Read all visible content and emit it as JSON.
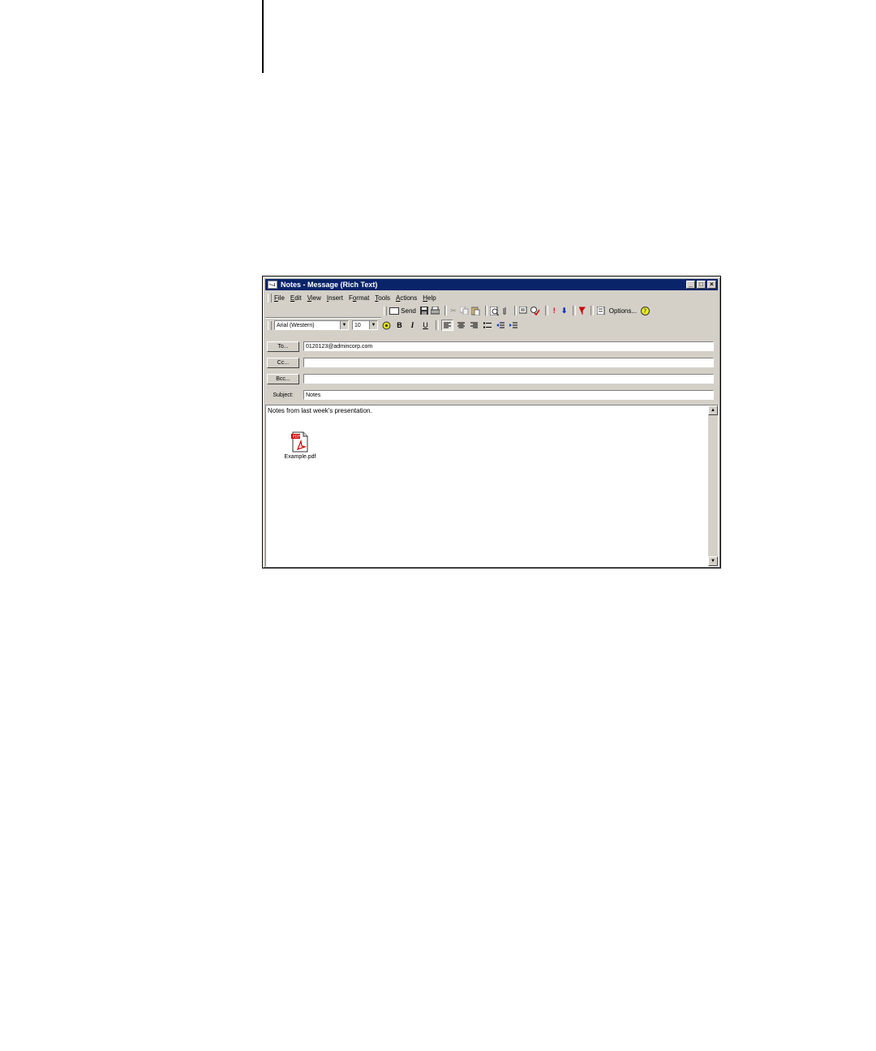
{
  "window": {
    "title": "Notes - Message (Rich Text)",
    "controls": [
      "_",
      "□",
      "×"
    ]
  },
  "menu": [
    {
      "label": "File",
      "u": "F",
      "rest": "ile"
    },
    {
      "label": "Edit",
      "u": "E",
      "rest": "dit"
    },
    {
      "label": "View",
      "u": "V",
      "rest": "iew"
    },
    {
      "label": "Insert",
      "u": "I",
      "rest": "nsert"
    },
    {
      "label": "Format",
      "u": "o",
      "pre": "F",
      "rest": "rmat"
    },
    {
      "label": "Tools",
      "u": "T",
      "rest": "ools"
    },
    {
      "label": "Actions",
      "u": "A",
      "rest": "ctions"
    },
    {
      "label": "Help",
      "u": "H",
      "rest": "elp"
    }
  ],
  "toolbar": {
    "send_label": "Send",
    "options_label": "Options..."
  },
  "format_toolbar": {
    "font": "Arial (Western)",
    "size": "10"
  },
  "header": {
    "to_button": "To...",
    "cc_button": "Cc...",
    "bcc_button": "Bcc...",
    "subject_label": "Subject:",
    "to_value": "0120123@admincorp.com",
    "cc_value": "",
    "bcc_value": "",
    "subject_value": "Notes"
  },
  "body": {
    "text": "Notes from last week's presentation.",
    "attachment_name": "Example.pdf",
    "attachment_badge": "PDF"
  },
  "colors": {
    "titlebar": "#0a246a",
    "chrome": "#d4d0c8",
    "pdf_red": "#cc0000"
  }
}
